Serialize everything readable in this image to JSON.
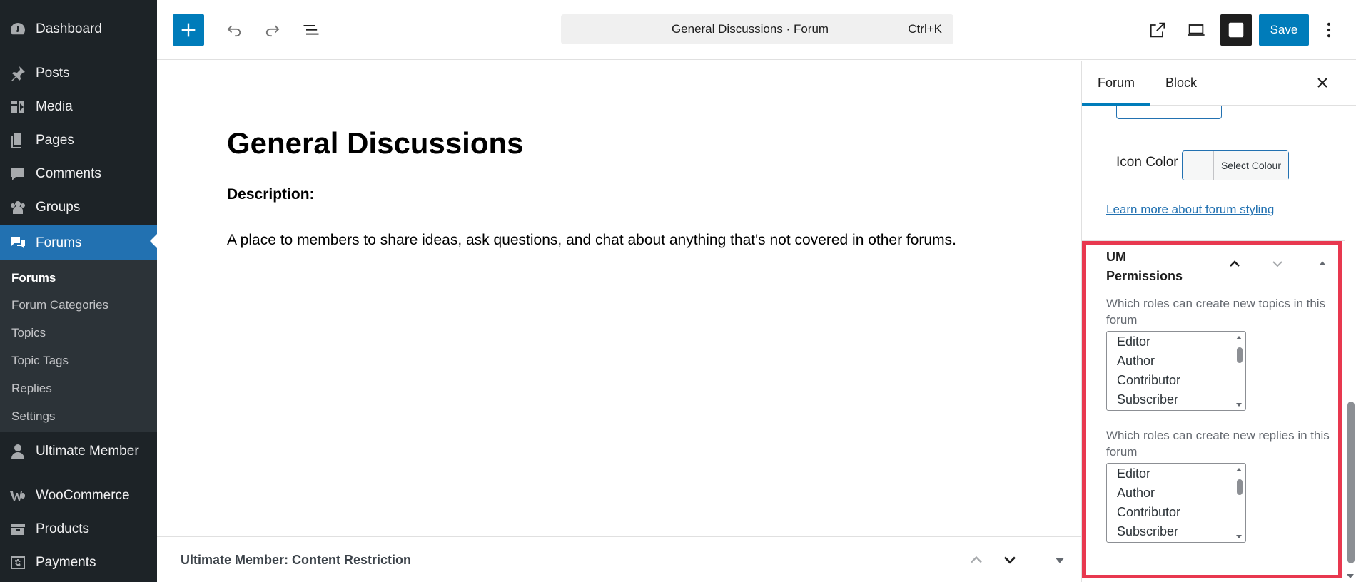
{
  "admin_menu": {
    "items": [
      {
        "label": "Dashboard",
        "icon": "dashboard-icon"
      },
      {
        "label": "Posts",
        "icon": "pin-icon"
      },
      {
        "label": "Media",
        "icon": "media-icon"
      },
      {
        "label": "Pages",
        "icon": "pages-icon"
      },
      {
        "label": "Comments",
        "icon": "comment-icon"
      },
      {
        "label": "Groups",
        "icon": "groups-icon"
      },
      {
        "label": "Forums",
        "icon": "forums-icon"
      },
      {
        "label": "Ultimate Member",
        "icon": "user-icon"
      },
      {
        "label": "WooCommerce",
        "icon": "woocommerce-icon"
      },
      {
        "label": "Products",
        "icon": "archive-icon"
      },
      {
        "label": "Payments",
        "icon": "dollar-icon"
      }
    ],
    "submenu": [
      "Forums",
      "Forum Categories",
      "Topics",
      "Topic Tags",
      "Replies",
      "Settings"
    ]
  },
  "toolbar": {
    "command_title": "General Discussions · Forum",
    "shortcut": "Ctrl+K",
    "save_label": "Save"
  },
  "post": {
    "title": "General Discussions",
    "description_label": "Description:",
    "description_text": "A place to members to share ideas, ask questions, and chat about anything that's not covered in other forums."
  },
  "metabox": {
    "title": "Ultimate Member: Content Restriction"
  },
  "settings": {
    "tabs": [
      "Forum",
      "Block"
    ],
    "icon_color_label": "Icon Color",
    "select_colour_label": "Select Colour",
    "styling_link": "Learn more about forum styling",
    "um_panel": {
      "title": "UM Permissions",
      "topics_help": "Which roles can create new topics in this forum",
      "replies_help": "Which roles can create new replies in this forum",
      "roles": [
        "Editor",
        "Author",
        "Contributor",
        "Subscriber"
      ]
    }
  },
  "colors": {
    "accent": "#007cba",
    "admin_bg": "#1d2327",
    "active_menu": "#2271b1",
    "highlight": "#e8384f"
  }
}
